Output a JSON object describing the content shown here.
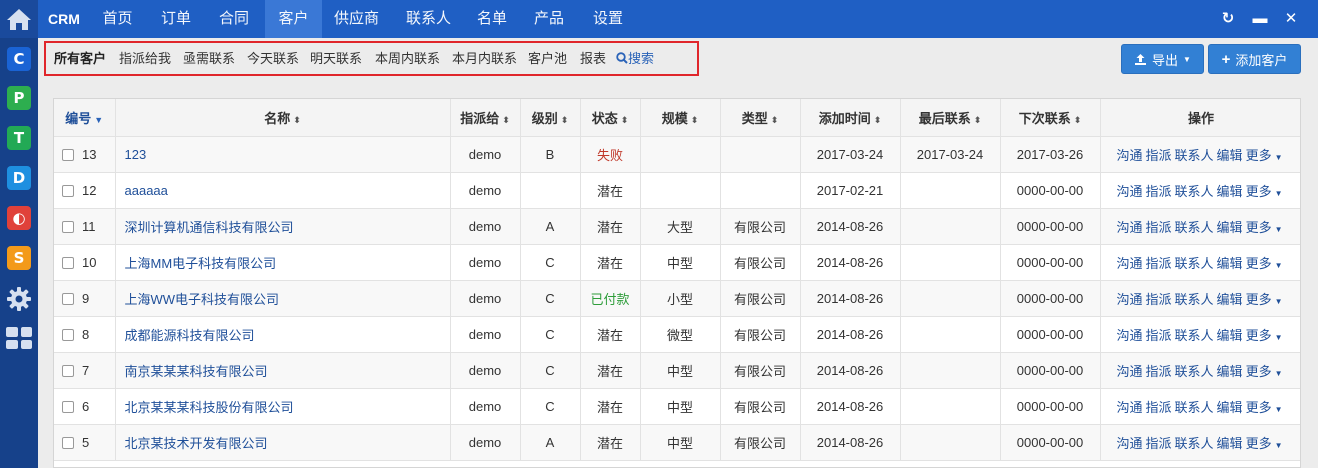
{
  "brand": "CRM",
  "nav": [
    "首页",
    "订单",
    "合同",
    "客户",
    "供应商",
    "联系人",
    "名单",
    "产品",
    "设置"
  ],
  "nav_active": "客户",
  "window_controls": [
    "refresh-icon",
    "minimize-icon",
    "close-icon"
  ],
  "dock_apps": [
    {
      "letter": "C",
      "color": "#1a63d4"
    },
    {
      "letter": "P",
      "color": "#2dae4f"
    },
    {
      "letter": "T",
      "color": "#22a955"
    },
    {
      "letter": "D",
      "color": "#1e8fe0"
    },
    {
      "letter": "◐",
      "color": "#e0413a"
    },
    {
      "letter": "S",
      "color": "#f39a1a"
    }
  ],
  "filters": [
    "所有客户",
    "指派给我",
    "亟需联系",
    "今天联系",
    "明天联系",
    "本周内联系",
    "本月内联系",
    "客户池",
    "报表"
  ],
  "search_label": "搜索",
  "export_label": "导出",
  "add_label": "添加客户",
  "columns": [
    "编号",
    "名称",
    "指派给",
    "级别",
    "状态",
    "规模",
    "类型",
    "添加时间",
    "最后联系",
    "下次联系",
    "操作"
  ],
  "op_labels": [
    "沟通",
    "指派",
    "联系人",
    "编辑",
    "更多"
  ],
  "rows": [
    {
      "id": "13",
      "name": "123",
      "assign": "demo",
      "level": "B",
      "status": "失败",
      "size": "",
      "type": "",
      "added": "2017-03-24",
      "last": "2017-03-24",
      "next": "2017-03-26"
    },
    {
      "id": "12",
      "name": "aaaaaa",
      "assign": "demo",
      "level": "",
      "status": "潜在",
      "size": "",
      "type": "",
      "added": "2017-02-21",
      "last": "",
      "next": "0000-00-00"
    },
    {
      "id": "11",
      "name": "深圳计算机通信科技有限公司",
      "assign": "demo",
      "level": "A",
      "status": "潜在",
      "size": "大型",
      "type": "有限公司",
      "added": "2014-08-26",
      "last": "",
      "next": "0000-00-00"
    },
    {
      "id": "10",
      "name": "上海MM电子科技有限公司",
      "assign": "demo",
      "level": "C",
      "status": "潜在",
      "size": "中型",
      "type": "有限公司",
      "added": "2014-08-26",
      "last": "",
      "next": "0000-00-00"
    },
    {
      "id": "9",
      "name": "上海WW电子科技有限公司",
      "assign": "demo",
      "level": "C",
      "status": "已付款",
      "size": "小型",
      "type": "有限公司",
      "added": "2014-08-26",
      "last": "",
      "next": "0000-00-00"
    },
    {
      "id": "8",
      "name": "成都能源科技有限公司",
      "assign": "demo",
      "level": "C",
      "status": "潜在",
      "size": "微型",
      "type": "有限公司",
      "added": "2014-08-26",
      "last": "",
      "next": "0000-00-00"
    },
    {
      "id": "7",
      "name": "南京某某某科技有限公司",
      "assign": "demo",
      "level": "C",
      "status": "潜在",
      "size": "中型",
      "type": "有限公司",
      "added": "2014-08-26",
      "last": "",
      "next": "0000-00-00"
    },
    {
      "id": "6",
      "name": "北京某某某科技股份有限公司",
      "assign": "demo",
      "level": "C",
      "status": "潜在",
      "size": "中型",
      "type": "有限公司",
      "added": "2014-08-26",
      "last": "",
      "next": "0000-00-00"
    },
    {
      "id": "5",
      "name": "北京某技术开发有限公司",
      "assign": "demo",
      "level": "A",
      "status": "潜在",
      "size": "中型",
      "type": "有限公司",
      "added": "2014-08-26",
      "last": "",
      "next": "0000-00-00"
    }
  ]
}
